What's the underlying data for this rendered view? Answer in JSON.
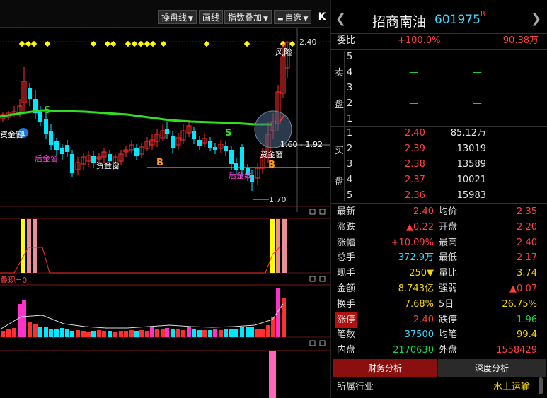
{
  "toolbar": {
    "items": [
      {
        "label": "操盘线",
        "dropdown": true
      },
      {
        "label": "画线",
        "dropdown": false
      },
      {
        "label": "指数叠加",
        "dropdown": true
      },
      {
        "label": "自选",
        "dropdown": true
      }
    ],
    "collapse_glyph": "K"
  },
  "chart": {
    "price_high_label": "2.40",
    "price_low_label": "1.70",
    "range_label": "1.60 - 1.92",
    "risk_label": "风险",
    "annotations": [
      "资金窗",
      "后金窗",
      "资金窗",
      "后金线",
      "资金窗"
    ],
    "signal_badge": "1",
    "s_marks": [
      "S",
      "S"
    ],
    "b_marks": [
      "B",
      "B"
    ],
    "indicator_label": "叠现=0",
    "colors": {
      "ma_line": "#33dd22",
      "up": "#ff3030",
      "down": "#00e8ff",
      "yellow": "#ffff00",
      "magenta": "#ff33cc",
      "pink": "#e89098"
    }
  },
  "quote": {
    "name": "招商南油",
    "code": "601975",
    "code_flag": "R",
    "webi_label": "委比",
    "webi": "+100.0%",
    "weicha": "90.38万",
    "sell_label": [
      "卖",
      "盘"
    ],
    "buy_label": [
      "买",
      "盘"
    ],
    "asks": [
      {
        "level": "5",
        "price": "—",
        "vol": "—"
      },
      {
        "level": "4",
        "price": "—",
        "vol": "—"
      },
      {
        "level": "3",
        "price": "—",
        "vol": "—"
      },
      {
        "level": "2",
        "price": "—",
        "vol": "—"
      },
      {
        "level": "1",
        "price": "—",
        "vol": "—"
      }
    ],
    "bids": [
      {
        "level": "1",
        "price": "2.40",
        "vol": "85.12万"
      },
      {
        "level": "2",
        "price": "2.39",
        "vol": "13019"
      },
      {
        "level": "3",
        "price": "2.38",
        "vol": "13589"
      },
      {
        "level": "4",
        "price": "2.37",
        "vol": "10021"
      },
      {
        "level": "5",
        "price": "2.36",
        "vol": "15983"
      }
    ],
    "stats": [
      {
        "l1": "最新",
        "v1": "2.40",
        "c1": "red",
        "l2": "均价",
        "v2": "2.35",
        "c2": "red"
      },
      {
        "l1": "涨跌",
        "v1": "▲0.22",
        "c1": "red",
        "l2": "开盘",
        "v2": "2.20",
        "c2": "red"
      },
      {
        "l1": "涨幅",
        "v1": "+10.09%",
        "c1": "red",
        "l2": "最高",
        "v2": "2.40",
        "c2": "red"
      },
      {
        "l1": "总手",
        "v1": "372.9万",
        "c1": "cyan",
        "l2": "最低",
        "v2": "2.17",
        "c2": "red"
      },
      {
        "l1": "现手",
        "v1": "250▼",
        "c1": "yellow",
        "l2": "量比",
        "v2": "3.74",
        "c2": "yellow"
      },
      {
        "l1": "金额",
        "v1": "8.743亿",
        "c1": "yellow",
        "l2": "强弱",
        "v2": "▲0.07",
        "c2": "red"
      },
      {
        "l1": "换手",
        "v1": "7.68%",
        "c1": "yellow",
        "l2": "5日",
        "v2": "26.75%",
        "c2": "yellow"
      },
      {
        "l1": "涨停",
        "v1": "2.40",
        "c1": "red",
        "l2": "跌停",
        "v2": "1.96",
        "c2": "green"
      },
      {
        "l1": "笔数",
        "v1": "37500",
        "c1": "cyan",
        "l2": "均笔",
        "v2": "99.4",
        "c2": "yellow"
      },
      {
        "l1": "内盘",
        "v1": "2170630",
        "c1": "green",
        "l2": "外盘",
        "v2": "1558429",
        "c2": "red"
      }
    ],
    "tabs": [
      "财务分析",
      "深度分析"
    ],
    "industry_label": "所属行业",
    "industry_value": "水上运输"
  }
}
